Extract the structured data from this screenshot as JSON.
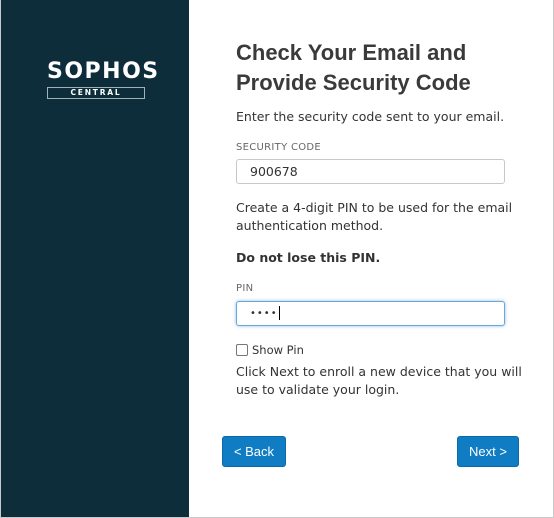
{
  "brand": {
    "name": "SOPHOS",
    "product": "CENTRAL"
  },
  "page": {
    "title": "Check Your Email and Provide Security Code",
    "intro": "Enter the security code sent to your email."
  },
  "security_code": {
    "label": "SECURITY CODE",
    "value": "900678"
  },
  "pin": {
    "description": "Create a 4-digit PIN to be used for the email authentication method.",
    "warning": "Do not lose this PIN.",
    "label": "PIN",
    "masked_value": "••••",
    "show_pin_label": "Show Pin",
    "show_pin_checked": false
  },
  "enroll_text": "Click Next to enroll a new device that you will use to validate your login.",
  "buttons": {
    "back": "< Back",
    "next": "Next >"
  },
  "colors": {
    "sidebar": "#0d2d3b",
    "button": "#0f7cc4",
    "focus_border": "#6aa8d8"
  }
}
